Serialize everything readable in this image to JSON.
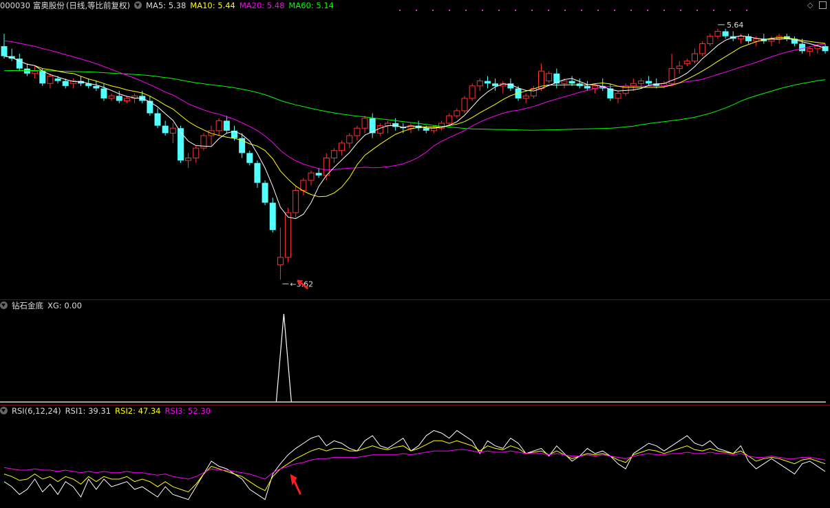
{
  "header": {
    "code": "000030",
    "name": "富奥股份",
    "mode": "(日线,等比前复权)",
    "ma5_label": "MA5:",
    "ma5": "5.38",
    "ma10_label": "MA10:",
    "ma10": "5.44",
    "ma20_label": "MA20:",
    "ma20": "5.48",
    "ma60_label": "MA60:",
    "ma60": "5.14"
  },
  "indicator": {
    "name": "钻石金底",
    "xg_label": "XG:",
    "xg": "0.00"
  },
  "rsi": {
    "name": "RSI(6,12,24)",
    "rsi1_label": "RSI1:",
    "rsi1": "39.31",
    "rsi2_label": "RSI2:",
    "rsi2": "47.34",
    "rsi3_label": "RSI3:",
    "rsi3": "52.30"
  },
  "colors": {
    "up": "#ff3232",
    "down": "#54ffff",
    "ma5": "#ffffff",
    "ma10": "#ffff00",
    "ma20": "#ff00ff",
    "ma60": "#00ff00",
    "separator": "#6a1010"
  },
  "chart_data": [
    {
      "type": "candlestick",
      "title": "富奥股份 (日线,等比前复权)",
      "ylim": [
        3.6,
        5.75
      ],
      "annotations": {
        "high": "5.64",
        "low": "3.62"
      },
      "candles": [
        [
          5.5,
          5.6,
          5.4,
          5.42
        ],
        [
          5.42,
          5.48,
          5.38,
          5.4
        ],
        [
          5.4,
          5.44,
          5.3,
          5.32
        ],
        [
          5.32,
          5.36,
          5.26,
          5.28
        ],
        [
          5.28,
          5.34,
          5.24,
          5.3
        ],
        [
          5.3,
          5.32,
          5.18,
          5.2
        ],
        [
          5.2,
          5.28,
          5.16,
          5.26
        ],
        [
          5.24,
          5.26,
          5.2,
          5.22
        ],
        [
          5.22,
          5.24,
          5.16,
          5.18
        ],
        [
          5.2,
          5.24,
          5.16,
          5.22
        ],
        [
          5.22,
          5.26,
          5.18,
          5.2
        ],
        [
          5.2,
          5.24,
          5.16,
          5.18
        ],
        [
          5.18,
          5.22,
          5.14,
          5.16
        ],
        [
          5.16,
          5.2,
          5.06,
          5.08
        ],
        [
          5.08,
          5.12,
          5.06,
          5.1
        ],
        [
          5.1,
          5.14,
          5.04,
          5.06
        ],
        [
          5.06,
          5.1,
          5.04,
          5.08
        ],
        [
          5.08,
          5.12,
          5.04,
          5.1
        ],
        [
          5.1,
          5.14,
          5.04,
          5.06
        ],
        [
          5.06,
          5.1,
          4.94,
          4.96
        ],
        [
          4.96,
          5.0,
          4.84,
          4.86
        ],
        [
          4.86,
          4.9,
          4.78,
          4.8
        ],
        [
          4.8,
          4.88,
          4.72,
          4.84
        ],
        [
          4.84,
          4.86,
          4.56,
          4.58
        ],
        [
          4.58,
          4.64,
          4.52,
          4.6
        ],
        [
          4.6,
          4.7,
          4.56,
          4.68
        ],
        [
          4.68,
          4.8,
          4.66,
          4.78
        ],
        [
          4.78,
          4.86,
          4.7,
          4.82
        ],
        [
          4.82,
          4.92,
          4.78,
          4.9
        ],
        [
          4.9,
          4.94,
          4.8,
          4.82
        ],
        [
          4.82,
          4.86,
          4.74,
          4.76
        ],
        [
          4.76,
          4.8,
          4.6,
          4.64
        ],
        [
          4.64,
          4.66,
          4.54,
          4.56
        ],
        [
          4.56,
          4.58,
          4.36,
          4.4
        ],
        [
          4.4,
          4.42,
          4.22,
          4.24
        ],
        [
          4.24,
          4.28,
          4.0,
          4.02
        ],
        [
          3.74,
          4.04,
          3.62,
          3.8
        ],
        [
          3.8,
          4.2,
          3.76,
          4.16
        ],
        [
          4.16,
          4.38,
          4.12,
          4.34
        ],
        [
          4.34,
          4.44,
          4.3,
          4.42
        ],
        [
          4.42,
          4.5,
          4.38,
          4.48
        ],
        [
          4.48,
          4.52,
          4.44,
          4.46
        ],
        [
          4.46,
          4.64,
          4.42,
          4.6
        ],
        [
          4.6,
          4.68,
          4.56,
          4.66
        ],
        [
          4.66,
          4.74,
          4.62,
          4.72
        ],
        [
          4.72,
          4.8,
          4.68,
          4.78
        ],
        [
          4.78,
          4.86,
          4.74,
          4.84
        ],
        [
          4.84,
          4.94,
          4.8,
          4.92
        ],
        [
          4.92,
          4.96,
          4.76,
          4.8
        ],
        [
          4.8,
          4.88,
          4.78,
          4.86
        ],
        [
          4.86,
          4.9,
          4.8,
          4.88
        ],
        [
          4.88,
          4.92,
          4.82,
          4.85
        ],
        [
          4.85,
          4.88,
          4.8,
          4.84
        ],
        [
          4.84,
          4.88,
          4.8,
          4.86
        ],
        [
          4.86,
          4.9,
          4.82,
          4.84
        ],
        [
          4.84,
          4.86,
          4.8,
          4.82
        ],
        [
          4.82,
          4.86,
          4.8,
          4.84
        ],
        [
          4.84,
          4.9,
          4.82,
          4.88
        ],
        [
          4.88,
          4.96,
          4.86,
          4.94
        ],
        [
          4.94,
          5.0,
          4.92,
          4.98
        ],
        [
          4.98,
          5.1,
          4.96,
          5.08
        ],
        [
          5.08,
          5.2,
          5.06,
          5.18
        ],
        [
          5.18,
          5.24,
          5.14,
          5.22
        ],
        [
          5.22,
          5.26,
          5.16,
          5.2
        ],
        [
          5.2,
          5.24,
          5.14,
          5.18
        ],
        [
          5.18,
          5.22,
          5.12,
          5.2
        ],
        [
          5.2,
          5.24,
          5.14,
          5.16
        ],
        [
          5.16,
          5.18,
          5.06,
          5.08
        ],
        [
          5.08,
          5.12,
          5.04,
          5.1
        ],
        [
          5.1,
          5.18,
          5.08,
          5.16
        ],
        [
          5.16,
          5.36,
          5.14,
          5.3
        ],
        [
          5.22,
          5.3,
          5.2,
          5.28
        ],
        [
          5.28,
          5.32,
          5.16,
          5.2
        ],
        [
          5.2,
          5.24,
          5.16,
          5.22
        ],
        [
          5.22,
          5.26,
          5.18,
          5.2
        ],
        [
          5.2,
          5.24,
          5.16,
          5.18
        ],
        [
          5.18,
          5.22,
          5.14,
          5.16
        ],
        [
          5.16,
          5.2,
          5.12,
          5.18
        ],
        [
          5.18,
          5.24,
          5.14,
          5.16
        ],
        [
          5.16,
          5.2,
          5.06,
          5.08
        ],
        [
          5.08,
          5.14,
          5.04,
          5.12
        ],
        [
          5.12,
          5.2,
          5.1,
          5.18
        ],
        [
          5.18,
          5.24,
          5.14,
          5.2
        ],
        [
          5.2,
          5.24,
          5.16,
          5.22
        ],
        [
          5.22,
          5.26,
          5.18,
          5.2
        ],
        [
          5.2,
          5.24,
          5.16,
          5.18
        ],
        [
          5.18,
          5.22,
          5.16,
          5.2
        ],
        [
          5.2,
          5.44,
          5.18,
          5.32
        ],
        [
          5.32,
          5.38,
          5.28,
          5.34
        ],
        [
          5.36,
          5.4,
          5.34,
          5.38
        ],
        [
          5.38,
          5.48,
          5.36,
          5.44
        ],
        [
          5.44,
          5.54,
          5.42,
          5.52
        ],
        [
          5.52,
          5.6,
          5.5,
          5.58
        ],
        [
          5.58,
          5.64,
          5.56,
          5.62
        ],
        [
          5.62,
          5.64,
          5.56,
          5.58
        ],
        [
          5.58,
          5.62,
          5.54,
          5.56
        ],
        [
          5.56,
          5.6,
          5.52,
          5.58
        ],
        [
          5.58,
          5.6,
          5.52,
          5.54
        ],
        [
          5.54,
          5.58,
          5.5,
          5.56
        ],
        [
          5.56,
          5.6,
          5.52,
          5.54
        ],
        [
          5.54,
          5.58,
          5.5,
          5.56
        ],
        [
          5.56,
          5.6,
          5.52,
          5.58
        ],
        [
          5.58,
          5.6,
          5.54,
          5.56
        ],
        [
          5.56,
          5.58,
          5.5,
          5.52
        ],
        [
          5.52,
          5.56,
          5.44,
          5.46
        ],
        [
          5.46,
          5.5,
          5.42,
          5.48
        ],
        [
          5.48,
          5.52,
          5.44,
          5.5
        ],
        [
          5.5,
          5.52,
          5.44,
          5.46
        ]
      ],
      "ma_labels": [
        "MA5",
        "MA10",
        "MA20",
        "MA60"
      ]
    },
    {
      "type": "line",
      "title": "钻石金底",
      "series": [
        {
          "name": "XG",
          "values": [
            0,
            0,
            0,
            0,
            0,
            0,
            0,
            0,
            0,
            0,
            0,
            0,
            0,
            0,
            0,
            0,
            0,
            0,
            0,
            0,
            0,
            0,
            0,
            0,
            0,
            0,
            0,
            0,
            0,
            0,
            0,
            0,
            0,
            0,
            0,
            0,
            1,
            0,
            0,
            0,
            0,
            0,
            0,
            0,
            0,
            0,
            0,
            0,
            0,
            0,
            0,
            0,
            0,
            0,
            0,
            0,
            0,
            0,
            0,
            0,
            0,
            0,
            0,
            0,
            0,
            0,
            0,
            0,
            0,
            0,
            0,
            0,
            0,
            0,
            0,
            0,
            0,
            0,
            0,
            0,
            0,
            0,
            0,
            0,
            0,
            0,
            0,
            0,
            0,
            0,
            0,
            0,
            0,
            0,
            0,
            0,
            0,
            0,
            0,
            0,
            0,
            0,
            0,
            0,
            0,
            0,
            0,
            0
          ]
        }
      ],
      "ylim": [
        0,
        1
      ]
    },
    {
      "type": "line",
      "title": "RSI(6,12,24)",
      "ylim": [
        15,
        85
      ],
      "series": [
        {
          "name": "RSI1",
          "values": [
            34,
            30,
            24,
            28,
            36,
            26,
            32,
            24,
            34,
            30,
            22,
            36,
            28,
            36,
            30,
            32,
            34,
            28,
            30,
            26,
            22,
            30,
            24,
            22,
            20,
            30,
            40,
            50,
            46,
            44,
            40,
            36,
            28,
            24,
            20,
            40,
            48,
            55,
            60,
            64,
            68,
            70,
            62,
            66,
            64,
            60,
            58,
            66,
            70,
            62,
            60,
            64,
            68,
            58,
            62,
            70,
            74,
            72,
            68,
            74,
            70,
            66,
            56,
            66,
            62,
            60,
            68,
            64,
            56,
            58,
            60,
            54,
            62,
            56,
            50,
            54,
            60,
            56,
            58,
            54,
            48,
            44,
            56,
            60,
            64,
            62,
            58,
            62,
            66,
            70,
            64,
            62,
            66,
            60,
            58,
            56,
            62,
            50,
            44,
            48,
            52,
            48,
            44,
            40,
            48,
            50,
            46,
            42
          ]
        },
        {
          "name": "RSI2",
          "values": [
            40,
            38,
            35,
            36,
            40,
            36,
            38,
            34,
            38,
            36,
            32,
            38,
            34,
            38,
            36,
            36,
            38,
            34,
            36,
            34,
            30,
            34,
            30,
            28,
            26,
            32,
            40,
            46,
            44,
            42,
            40,
            38,
            34,
            30,
            27,
            38,
            44,
            48,
            52,
            55,
            58,
            60,
            58,
            60,
            60,
            58,
            58,
            60,
            62,
            60,
            59,
            61,
            62,
            58,
            60,
            63,
            66,
            66,
            64,
            66,
            64,
            62,
            58,
            62,
            60,
            59,
            62,
            60,
            56,
            57,
            58,
            55,
            58,
            55,
            52,
            54,
            56,
            55,
            56,
            54,
            51,
            49,
            55,
            57,
            59,
            58,
            56,
            58,
            60,
            62,
            59,
            58,
            60,
            58,
            57,
            56,
            58,
            54,
            50,
            52,
            53,
            52,
            50,
            48,
            51,
            52,
            50,
            48
          ]
        },
        {
          "name": "RSI3",
          "values": [
            45,
            44,
            43,
            43,
            44,
            43,
            43,
            42,
            43,
            42,
            41,
            42,
            41,
            42,
            41,
            41,
            42,
            41,
            41,
            40,
            39,
            40,
            38,
            37,
            36,
            38,
            41,
            44,
            43,
            43,
            42,
            41,
            40,
            38,
            36,
            41,
            44,
            46,
            48,
            49,
            51,
            52,
            52,
            53,
            53,
            53,
            53,
            54,
            55,
            55,
            55,
            55,
            56,
            55,
            56,
            57,
            58,
            58,
            58,
            59,
            59,
            58,
            57,
            58,
            57,
            57,
            58,
            57,
            56,
            56,
            56,
            55,
            56,
            55,
            54,
            54,
            55,
            54,
            55,
            54,
            53,
            52,
            54,
            55,
            56,
            55,
            55,
            56,
            56,
            57,
            56,
            56,
            57,
            56,
            56,
            55,
            56,
            54,
            53,
            53,
            54,
            53,
            52,
            52,
            53,
            53,
            52,
            51
          ]
        }
      ]
    }
  ]
}
